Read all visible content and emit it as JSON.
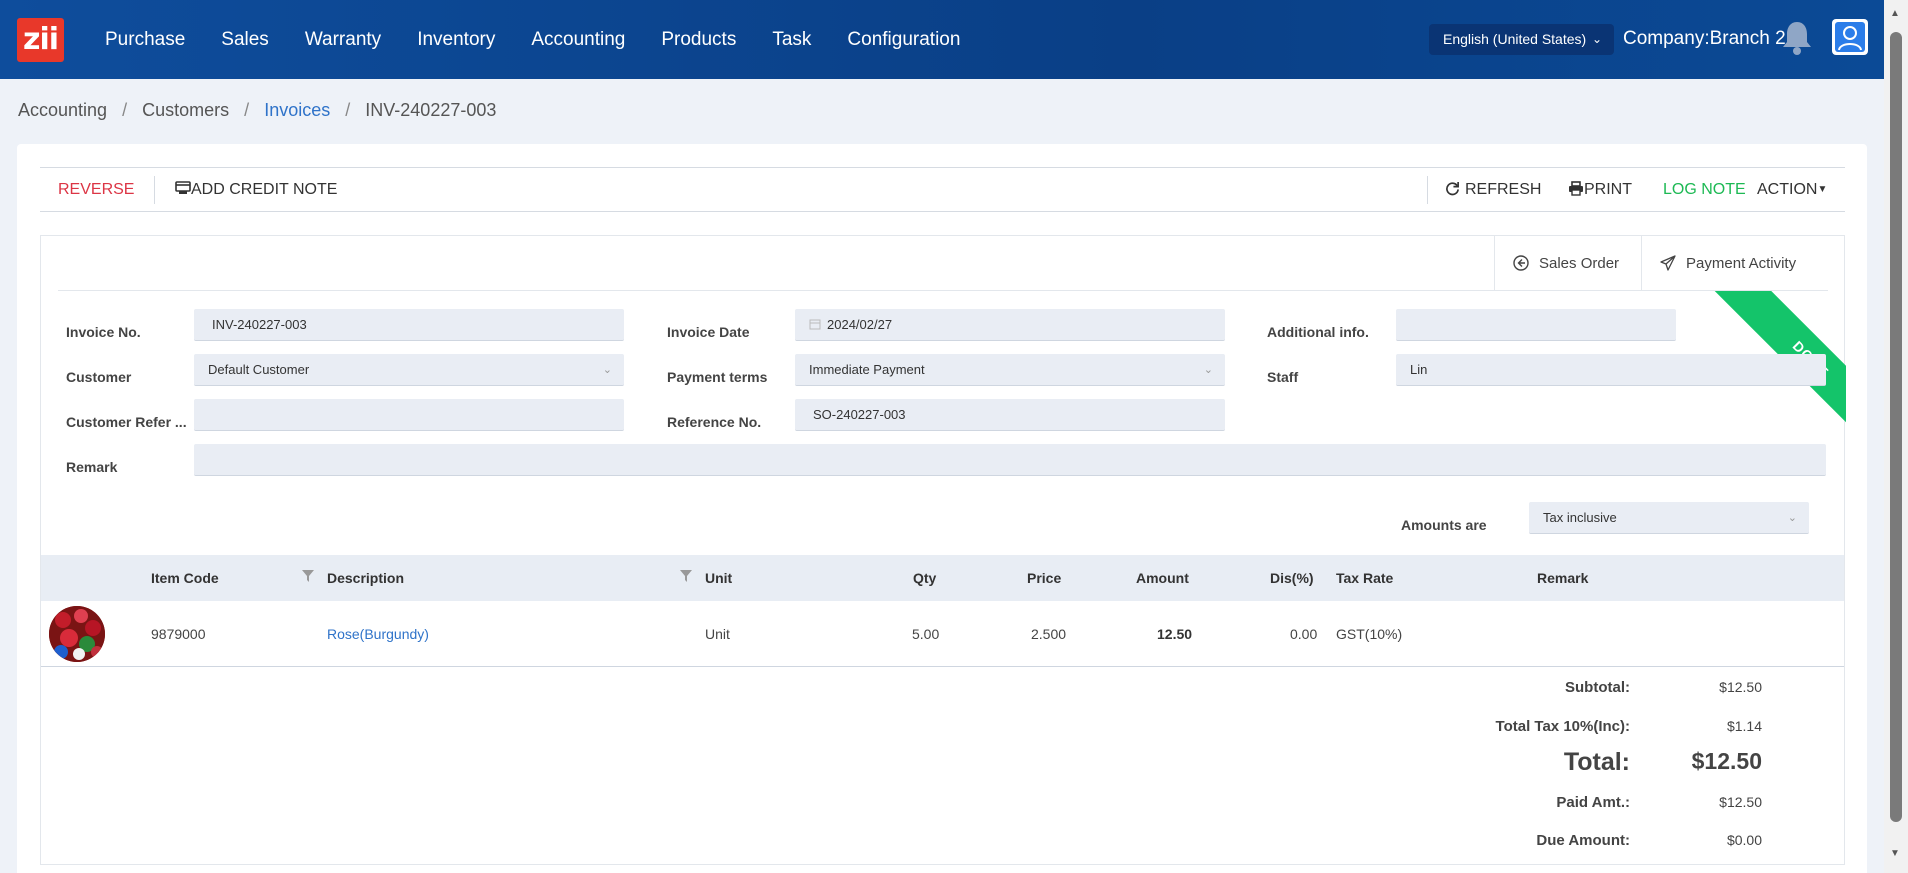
{
  "logo": "zii",
  "nav": [
    "Purchase",
    "Sales",
    "Warranty",
    "Inventory",
    "Accounting",
    "Products",
    "Task",
    "Configuration"
  ],
  "language": "English (United States)",
  "company": "Company:Branch 2",
  "breadcrumb": {
    "accounting": "Accounting",
    "customers": "Customers",
    "invoices": "Invoices",
    "current": "INV-240227-003"
  },
  "toolbar": {
    "reverse": "REVERSE",
    "add_credit_note": "ADD CREDIT NOTE",
    "refresh": "REFRESH",
    "print": "PRINT",
    "log_note": "LOG NOTE",
    "action": "ACTION"
  },
  "smart_buttons": {
    "sales_order": "Sales Order",
    "payment_activity": "Payment Activity"
  },
  "status_ribbon": "DONE",
  "form": {
    "invoice_no_label": "Invoice No.",
    "invoice_no": "INV-240227-003",
    "invoice_date_label": "Invoice Date",
    "invoice_date": "2024/02/27",
    "additional_info_label": "Additional info.",
    "additional_info": "",
    "customer_label": "Customer",
    "customer": "Default Customer",
    "payment_terms_label": "Payment terms",
    "payment_terms": "Immediate Payment",
    "staff_label": "Staff",
    "staff": "Lin",
    "customer_ref_label": "Customer Refer ...",
    "customer_ref": "",
    "reference_no_label": "Reference No.",
    "reference_no": "SO-240227-003",
    "remark_label": "Remark",
    "remark": "",
    "amounts_are_label": "Amounts are",
    "amounts_are": "Tax inclusive"
  },
  "table": {
    "headers": {
      "item_code": "Item Code",
      "description": "Description",
      "unit": "Unit",
      "qty": "Qty",
      "price": "Price",
      "amount": "Amount",
      "discount": "Dis(%)",
      "tax_rate": "Tax Rate",
      "remark": "Remark"
    },
    "rows": [
      {
        "item_code": "9879000",
        "description": "Rose(Burgundy)",
        "unit": "Unit",
        "qty": "5.00",
        "price": "2.500",
        "amount": "12.50",
        "discount": "0.00",
        "tax_rate": "GST(10%)",
        "remark": ""
      }
    ]
  },
  "totals": {
    "subtotal_label": "Subtotal:",
    "subtotal": "$12.50",
    "tax_label": "Total Tax 10%(Inc):",
    "tax": "$1.14",
    "total_label": "Total:",
    "total": "$12.50",
    "paid_label": "Paid Amt.:",
    "paid": "$12.50",
    "due_label": "Due Amount:",
    "due": "$0.00"
  },
  "colors": {
    "header_bg": "#0e4d9c",
    "logo_bg": "#e8382a",
    "reverse": "#dc3545",
    "log_note": "#1db954",
    "link": "#2f73c9",
    "ribbon": "#14c46a"
  }
}
